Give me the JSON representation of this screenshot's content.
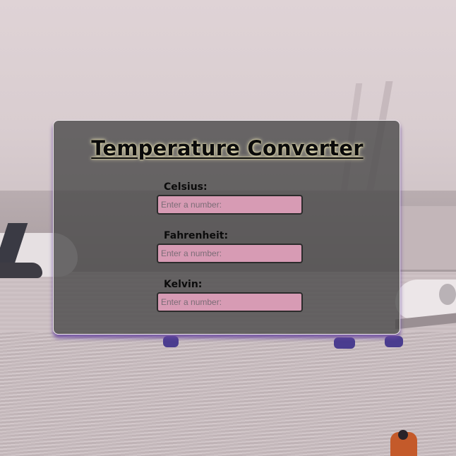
{
  "app": {
    "title": "Temperature Converter"
  },
  "fields": [
    {
      "label": "Celsius:",
      "value": "",
      "placeholder": "Enter a number:"
    },
    {
      "label": "Fahrenheit:",
      "value": "",
      "placeholder": "Enter a number:"
    },
    {
      "label": "Kelvin:",
      "value": "",
      "placeholder": "Enter a number:"
    }
  ],
  "colors": {
    "input_background": "#d79bb4",
    "card_background": "#464646",
    "card_shadow": "#6946a0"
  },
  "background": {
    "image": "airport-apron-photo"
  }
}
